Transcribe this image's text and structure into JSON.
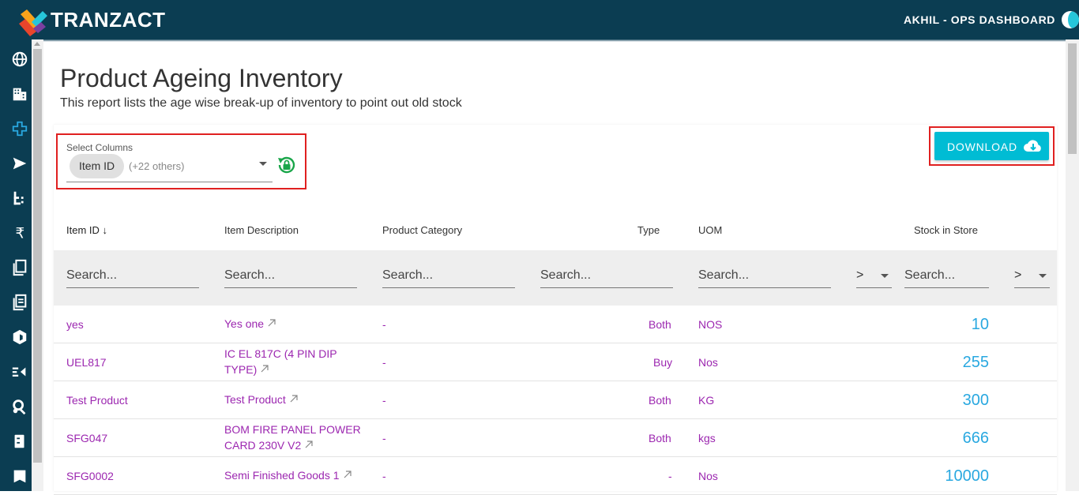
{
  "brand": {
    "name": "TRANZACT"
  },
  "header": {
    "user_label": "AKHIL - OPS DASHBOARD"
  },
  "sidebar": {
    "icons": [
      "globe-icon",
      "building-icon",
      "plus-icon",
      "send-icon",
      "list-icon",
      "rupee-icon",
      "documents-icon",
      "files-icon",
      "box-icon",
      "process-icon",
      "settings-icon",
      "book-icon",
      "bookmark-icon"
    ]
  },
  "page": {
    "title": "Product Ageing Inventory",
    "subtitle": "This report lists the age wise break-up of inventory to point out old stock"
  },
  "columns_select": {
    "label": "Select Columns",
    "chip": "Item ID",
    "others": "(+22 others)"
  },
  "download": {
    "label": "DOWNLOAD"
  },
  "table": {
    "headers": {
      "item_id": "Item ID",
      "item_id_sort": "↓",
      "description": "Item Description",
      "category": "Product Category",
      "type": "Type",
      "uom": "UOM",
      "stock": "Stock in Store"
    },
    "search_placeholder": "Search...",
    "operator": ">",
    "rows": [
      {
        "id": "yes",
        "desc": "Yes one",
        "category": "-",
        "type": "Both",
        "uom": "NOS",
        "stock": "10"
      },
      {
        "id": "UEL817",
        "desc": "IC EL 817C (4 PIN DIP TYPE)",
        "category": "-",
        "type": "Buy",
        "uom": "Nos",
        "stock": "255"
      },
      {
        "id": "Test Product",
        "desc": "Test Product",
        "category": "-",
        "type": "Both",
        "uom": "KG",
        "stock": "300"
      },
      {
        "id": "SFG047",
        "desc": "BOM FIRE PANEL POWER CARD 230V V2",
        "category": "-",
        "type": "Both",
        "uom": "kgs",
        "stock": "666"
      },
      {
        "id": "SFG0002",
        "desc": "Semi Finished Goods 1",
        "category": "-",
        "type": "-",
        "uom": "Nos",
        "stock": "10000"
      }
    ]
  },
  "colors": {
    "topbar": "#0b3d52",
    "accent": "#00bcd4",
    "link": "#9c27b0",
    "stock": "#29a8e0",
    "highlight": "#e02020"
  }
}
